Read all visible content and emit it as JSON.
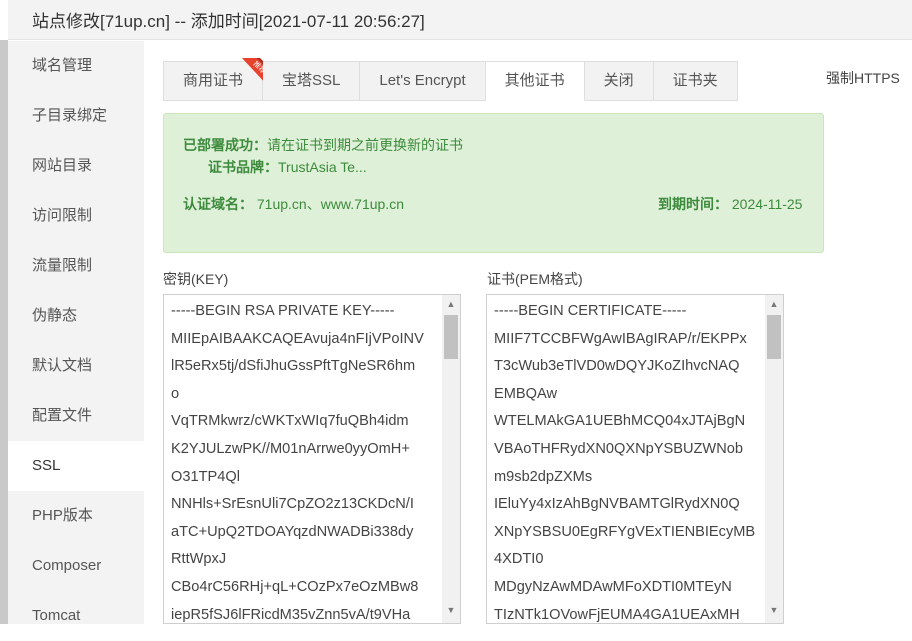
{
  "window": {
    "title": "站点修改[71up.cn] -- 添加时间[2021-07-11 20:56:27]"
  },
  "sidebar": {
    "items": [
      {
        "label": "域名管理"
      },
      {
        "label": "子目录绑定"
      },
      {
        "label": "网站目录"
      },
      {
        "label": "访问限制"
      },
      {
        "label": "流量限制"
      },
      {
        "label": "伪静态"
      },
      {
        "label": "默认文档"
      },
      {
        "label": "配置文件"
      },
      {
        "label": "SSL",
        "active": true
      },
      {
        "label": "PHP版本"
      },
      {
        "label": "Composer"
      },
      {
        "label": "Tomcat"
      }
    ]
  },
  "tabs": [
    {
      "label": "商用证书",
      "badge": "推荐"
    },
    {
      "label": "宝塔SSL"
    },
    {
      "label": "Let's Encrypt"
    },
    {
      "label": "其他证书",
      "active": true
    },
    {
      "label": "关闭"
    },
    {
      "label": "证书夹"
    }
  ],
  "force_https": {
    "label": "强制HTTPS"
  },
  "status": {
    "deployed_label": "已部署成功：",
    "deployed_text": "请在证书到期之前更换新的证书",
    "brand_label": "证书品牌：",
    "brand_value": "TrustAsia Te...",
    "domain_label": "认证域名：",
    "domain_value": "71up.cn、www.71up.cn",
    "expiry_label": "到期时间：",
    "expiry_value": "2024-11-25"
  },
  "key_field": {
    "label": "密钥(KEY)",
    "value": "-----BEGIN RSA PRIVATE KEY-----\nMIIEpAIBAAKCAQEAvuja4nFIjVPoINV\nlR5eRx5tj/dSfiJhuGssPftTgNeSR6hm\no\nVqTRMkwrz/cWKTxWIq7fuQBh4idm\nK2YJULzwPK//M01nArrwe0yyOmH+\nO31TP4Ql\nNNHls+SrEsnUli7CpZO2z13CKDcN/I\naTC+UpQ2TDOAYqzdNWADBi338dy\nRttWpxJ\nCBo4rC56RHj+qL+COzPx7eOzMBw8\niepR5fSJ6lFRicdM35vZnn5vA/t9VHa"
  },
  "cert_field": {
    "label": "证书(PEM格式)",
    "value": "-----BEGIN CERTIFICATE-----\nMIIF7TCCBFWgAwIBAgIRAP/r/EKPPx\nT3cWub3eTlVD0wDQYJKoZIhvcNAQ\nEMBQAw\nWTELMAkGA1UEBhMCQ04xJTAjBgN\nVBAoTHFRydXN0QXNpYSBUZWNob\nm9sb2dpZXMs\nIEluYy4xIzAhBgNVBAMTGlRydXN0Q\nXNpYSBSU0EgRFYgVExTIENBIEcyMB\n4XDTI0\nMDgyNzAwMDAwMFoXDTI0MTEyN\nTIzNTk1OVowFjEUMA4GA1UEAxMH"
  }
}
